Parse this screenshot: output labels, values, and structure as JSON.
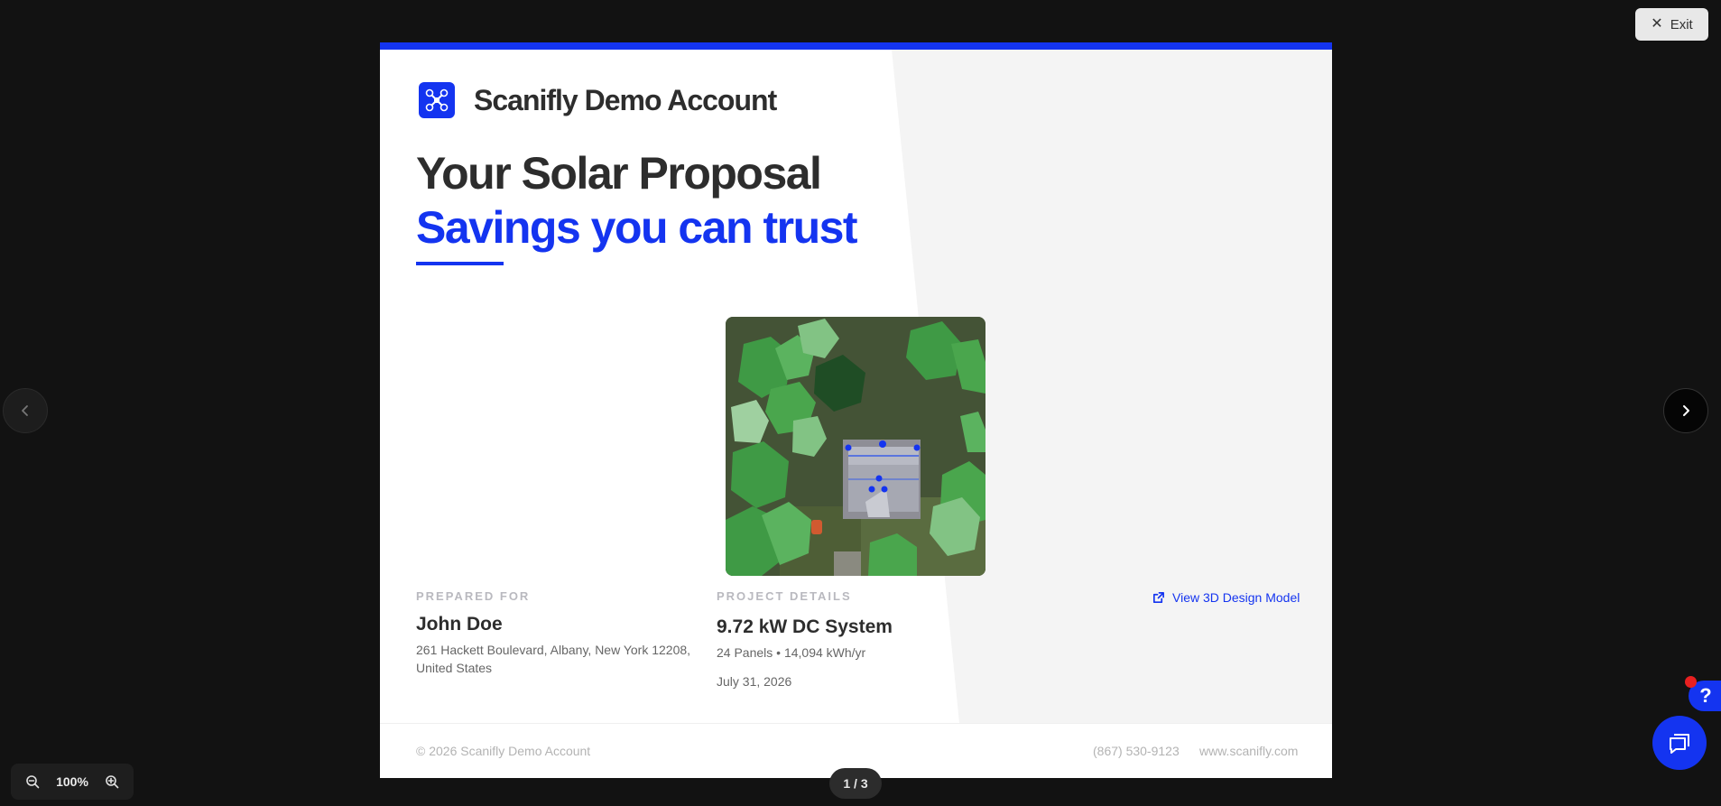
{
  "exit": {
    "label": "Exit"
  },
  "slide": {
    "company": "Scanifly Demo Account",
    "headline": "Your Solar Proposal",
    "subheadline": "Savings you can trust",
    "prepared_for": {
      "label": "PREPARED FOR",
      "name": "John Doe",
      "address_line1": "261 Hackett Boulevard, Albany, New York 12208,",
      "address_line2": "United States"
    },
    "project": {
      "label": "PROJECT DETAILS",
      "system": "9.72 kW DC System",
      "stats": "24 Panels • 14,094 kWh/yr",
      "date": "July 31, 2026"
    },
    "view3d": "View 3D Design Model",
    "footer": {
      "copyright": "© 2026 Scanifly Demo Account",
      "phone": "(867) 530-9123",
      "website": "www.scanifly.com"
    }
  },
  "pager": {
    "indicator": "1 / 3"
  },
  "zoom": {
    "level": "100%"
  },
  "help": {
    "label": "?"
  },
  "colors": {
    "brand": "#1434f0",
    "background": "#121212",
    "alert": "#e82020"
  },
  "icons": [
    "close-icon",
    "chevron-left-icon",
    "chevron-right-icon",
    "external-link-icon",
    "zoom-out-icon",
    "zoom-in-icon",
    "chat-icon",
    "drone-logo-icon"
  ]
}
